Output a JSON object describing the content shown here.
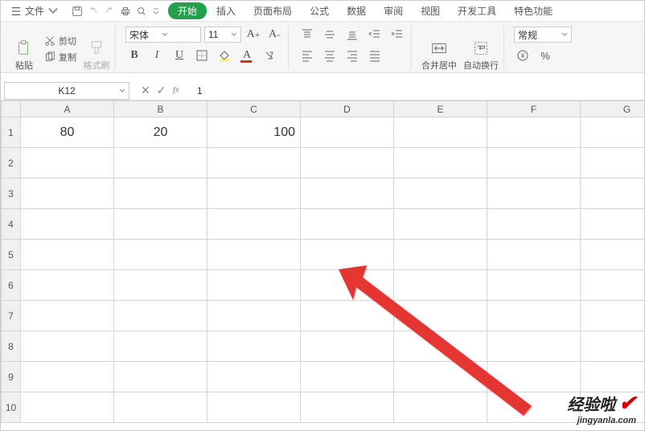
{
  "menu": {
    "file": "文件",
    "tabs": [
      "开始",
      "插入",
      "页面布局",
      "公式",
      "数据",
      "审阅",
      "视图",
      "开发工具",
      "特色功能"
    ]
  },
  "ribbon": {
    "paste": "粘贴",
    "cut": "剪切",
    "copy": "复制",
    "formatpainter": "格式刷",
    "fontname": "宋体",
    "fontsize": "11",
    "merge": "合并居中",
    "wrap": "自动换行",
    "numfmt": "常规"
  },
  "namebox": "K12",
  "formula": "1",
  "columns": [
    "A",
    "B",
    "C",
    "D",
    "E",
    "F",
    "G"
  ],
  "rows": [
    "1",
    "2",
    "3",
    "4",
    "5",
    "6",
    "7",
    "8",
    "9",
    "10"
  ],
  "cells": {
    "A1": "80",
    "B1": "20",
    "C1": "100"
  },
  "watermark": {
    "line1": "经验啦",
    "line2": "jingyanla.com"
  }
}
